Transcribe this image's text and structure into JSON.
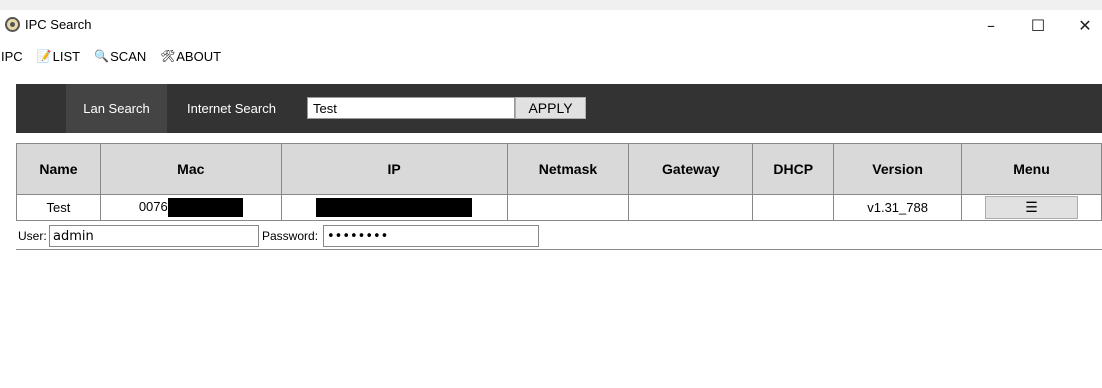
{
  "window": {
    "title": "IPC Search",
    "minimize_glyph": "–",
    "maximize_glyph": "☐",
    "close_glyph": "✕"
  },
  "menu": {
    "ipc_label": "IPC",
    "list_label": "LIST",
    "scan_label": "SCAN",
    "about_label": "ABOUT",
    "list_icon": "📝",
    "scan_icon": "🔍",
    "about_icon": "🛠"
  },
  "toolbar": {
    "lan_tab_label": "Lan Search",
    "internet_tab_label": "Internet Search",
    "search_value": "Test",
    "apply_label": "APPLY"
  },
  "table": {
    "headers": [
      "Name",
      "Mac",
      "IP",
      "Netmask",
      "Gateway",
      "DHCP",
      "Version",
      "Menu"
    ],
    "rows": [
      {
        "name": "Test",
        "mac_visible": "0076",
        "netmask": "",
        "gateway": "",
        "dhcp": "",
        "version": "v1.31_788",
        "menu_glyph": "☰"
      }
    ]
  },
  "credentials": {
    "user_label": "User:",
    "user_value": "admin",
    "password_label": "Password:",
    "password_mask": "••••••••"
  },
  "colors": {
    "toolbar_bg": "#333333",
    "active_tab_bg": "#444444",
    "header_bg": "#d9d9d9"
  }
}
